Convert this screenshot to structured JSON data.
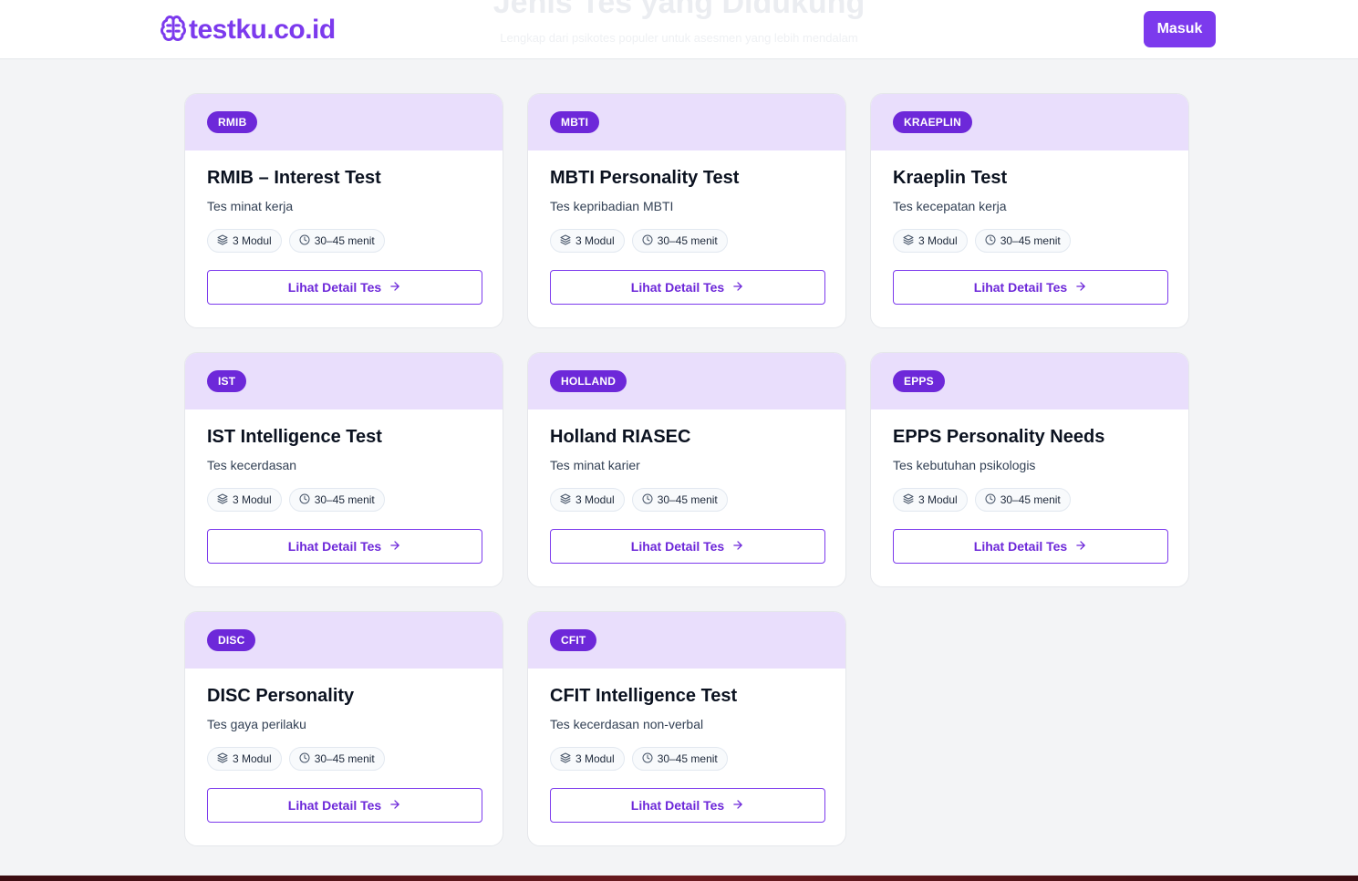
{
  "background_section": {
    "title": "Jenis Tes yang Didukung",
    "subtitle": "Lengkap dari psikotes populer untuk asesmen yang lebih mendalam"
  },
  "header": {
    "logo_text": "testku.co.id",
    "logo_icon": "brain-icon",
    "login_label": "Masuk"
  },
  "colors": {
    "accent": "#7c3aed",
    "badge": "#6d28d9",
    "card_header": "#e9defc"
  },
  "cards": [
    {
      "badge": "RMIB",
      "title": "RMIB – Interest Test",
      "desc": "Tes minat kerja",
      "modules": "3 Modul",
      "duration": "30–45 menit",
      "button": "Lihat Detail Tes"
    },
    {
      "badge": "MBTI",
      "title": "MBTI Personality Test",
      "desc": "Tes kepribadian MBTI",
      "modules": "3 Modul",
      "duration": "30–45 menit",
      "button": "Lihat Detail Tes"
    },
    {
      "badge": "KRAEPLIN",
      "title": "Kraeplin Test",
      "desc": "Tes kecepatan kerja",
      "modules": "3 Modul",
      "duration": "30–45 menit",
      "button": "Lihat Detail Tes"
    },
    {
      "badge": "IST",
      "title": "IST Intelligence Test",
      "desc": "Tes kecerdasan",
      "modules": "3 Modul",
      "duration": "30–45 menit",
      "button": "Lihat Detail Tes"
    },
    {
      "badge": "HOLLAND",
      "title": "Holland RIASEC",
      "desc": "Tes minat karier",
      "modules": "3 Modul",
      "duration": "30–45 menit",
      "button": "Lihat Detail Tes"
    },
    {
      "badge": "EPPS",
      "title": "EPPS Personality Needs",
      "desc": "Tes kebutuhan psikologis",
      "modules": "3 Modul",
      "duration": "30–45 menit",
      "button": "Lihat Detail Tes"
    },
    {
      "badge": "DISC",
      "title": "DISC Personality",
      "desc": "Tes gaya perilaku",
      "modules": "3 Modul",
      "duration": "30–45 menit",
      "button": "Lihat Detail Tes"
    },
    {
      "badge": "CFIT",
      "title": "CFIT Intelligence Test",
      "desc": "Tes kecerdasan non-verbal",
      "modules": "3 Modul",
      "duration": "30–45 menit",
      "button": "Lihat Detail Tes"
    }
  ]
}
